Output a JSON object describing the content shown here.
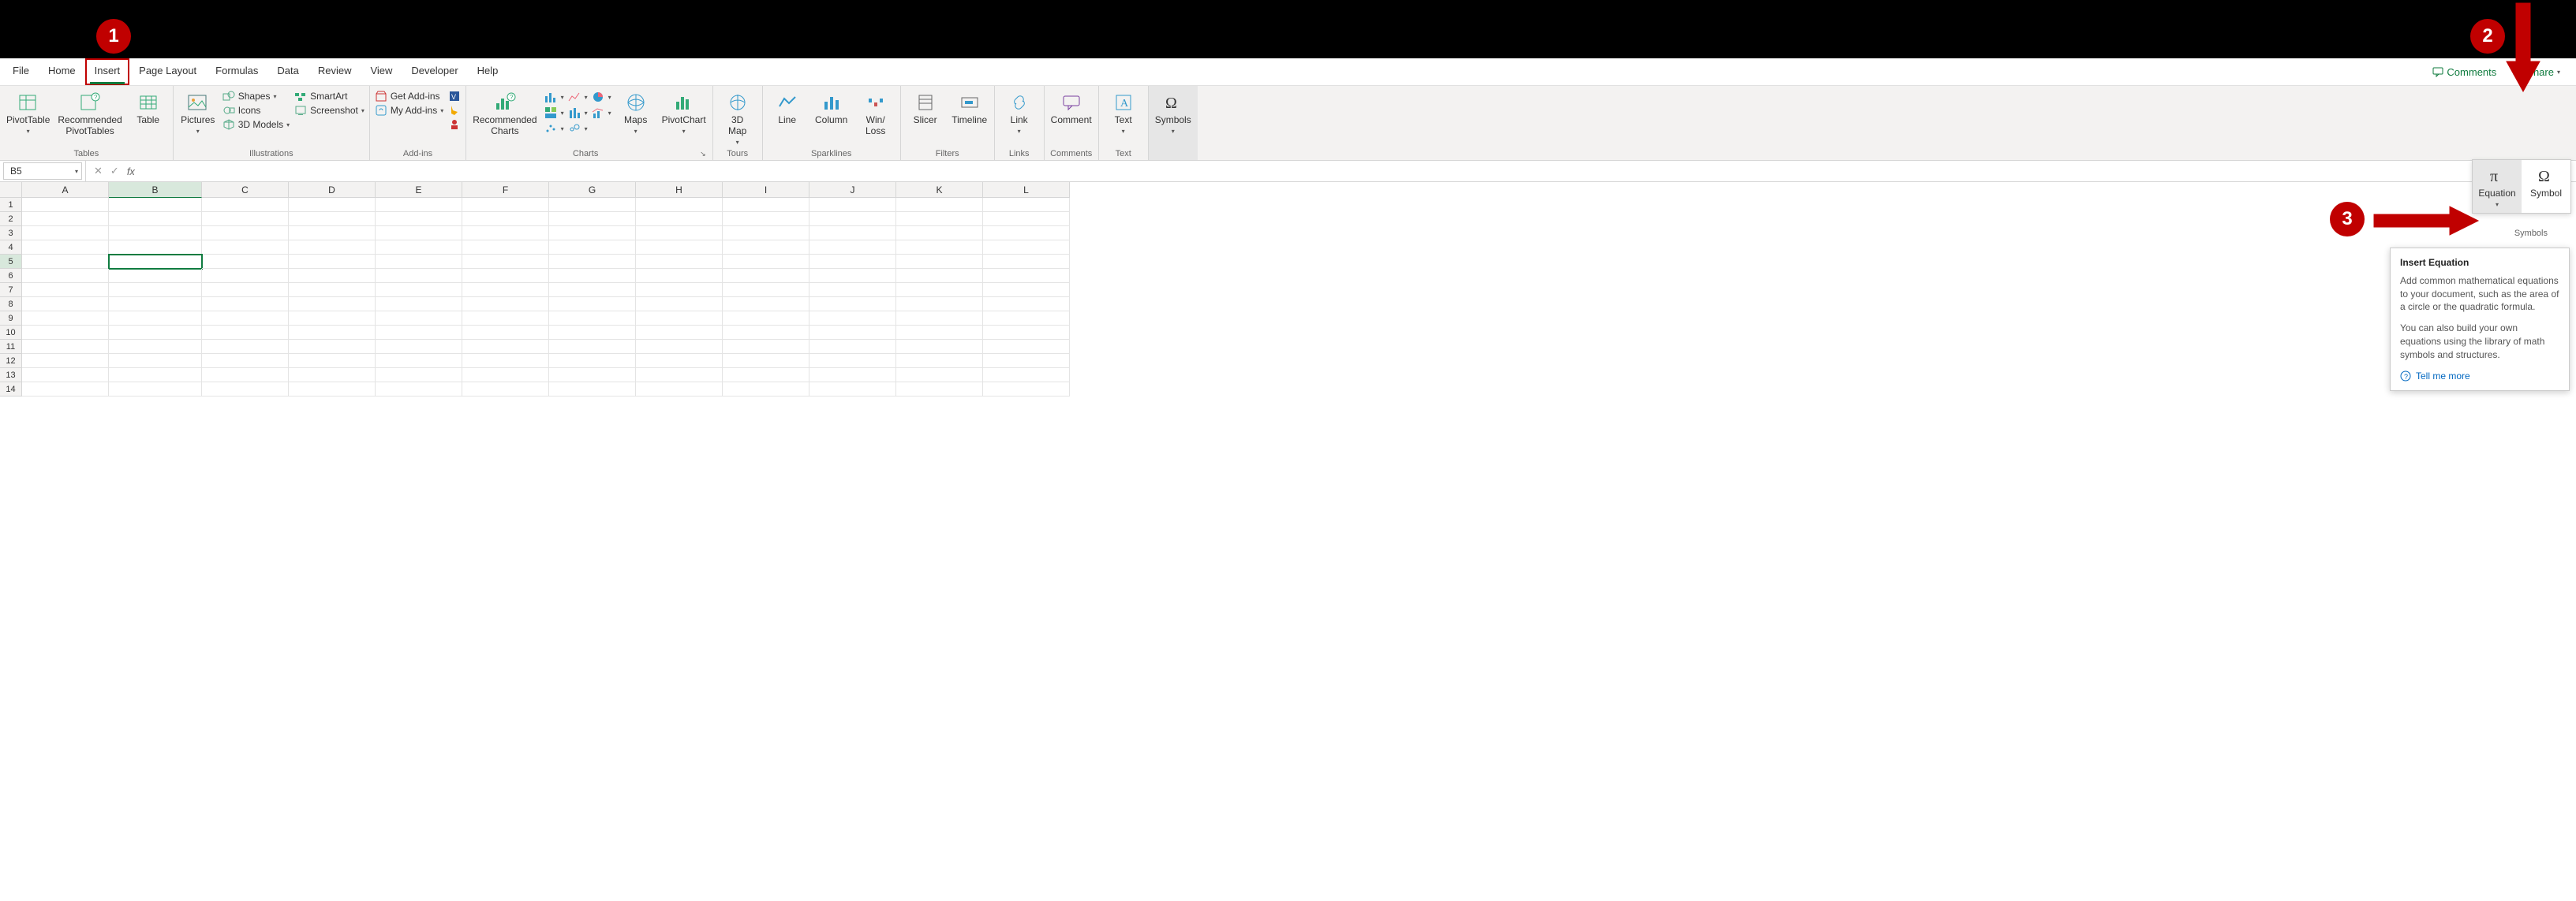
{
  "menu": {
    "items": [
      "File",
      "Home",
      "Insert",
      "Page Layout",
      "Formulas",
      "Data",
      "Review",
      "View",
      "Developer",
      "Help"
    ],
    "active": "Insert",
    "comments": "Comments",
    "share": "Share"
  },
  "ribbon": {
    "groups": {
      "tables": {
        "label": "Tables",
        "pivottable": "PivotTable",
        "recommended_pt": "Recommended\nPivotTables",
        "table": "Table"
      },
      "illustrations": {
        "label": "Illustrations",
        "pictures": "Pictures",
        "shapes": "Shapes",
        "icons": "Icons",
        "models3d": "3D Models",
        "smartart": "SmartArt",
        "screenshot": "Screenshot"
      },
      "addins": {
        "label": "Add-ins",
        "get": "Get Add-ins",
        "my": "My Add-ins",
        "bing": "Bing Maps",
        "people": "People Graph",
        "visio": "Visio Data Visualizer"
      },
      "charts": {
        "label": "Charts",
        "recommended": "Recommended\nCharts",
        "maps": "Maps",
        "pivotchart": "PivotChart"
      },
      "tours": {
        "label": "Tours",
        "map3d": "3D\nMap"
      },
      "sparklines": {
        "label": "Sparklines",
        "line": "Line",
        "column": "Column",
        "winloss": "Win/\nLoss"
      },
      "filters": {
        "label": "Filters",
        "slicer": "Slicer",
        "timeline": "Timeline"
      },
      "links": {
        "label": "Links",
        "link": "Link"
      },
      "comments": {
        "label": "Comments",
        "comment": "Comment"
      },
      "text": {
        "label": "Text",
        "text": "Text"
      },
      "symbols": {
        "label": "Symbols",
        "symbols": "Symbols",
        "equation": "Equation",
        "symbol": "Symbol"
      }
    }
  },
  "namebox": "B5",
  "columns": [
    "A",
    "B",
    "C",
    "D",
    "E",
    "F",
    "G",
    "H",
    "I",
    "J",
    "K",
    "L"
  ],
  "rows": [
    1,
    2,
    3,
    4,
    5,
    6,
    7,
    8,
    9,
    10,
    11,
    12,
    13,
    14
  ],
  "active_cell": {
    "col": "B",
    "row": 5
  },
  "tooltip": {
    "title": "Insert Equation",
    "p1": "Add common mathematical equations to your document, such as the area of a circle or the quadratic formula.",
    "p2": "You can also build your own equations using the library of math symbols and structures.",
    "link": "Tell me more"
  },
  "badges": {
    "b1": "1",
    "b2": "2",
    "b3": "3"
  }
}
